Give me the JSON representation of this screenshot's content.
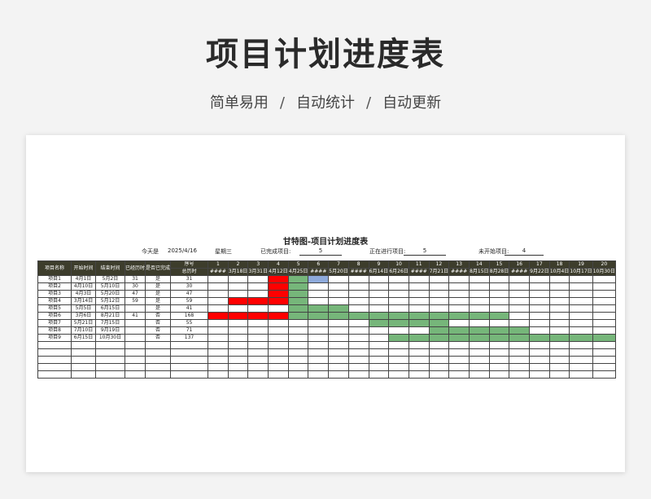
{
  "header": {
    "title": "项目计划进度表",
    "tagline": [
      "简单易用",
      "自动统计",
      "自动更新"
    ],
    "separator": "/"
  },
  "sheet": {
    "title": "甘特图-项目计划进度表",
    "today_label": "今天是",
    "today_date": "2025/4/16",
    "weekday": "星期三",
    "done_label": "已完成项目:",
    "done_value": "5",
    "inprogress_label": "正在进行项目:",
    "inprogress_value": "5",
    "notstarted_label": "未开始项目:",
    "notstarted_value": "4"
  },
  "table": {
    "columns": [
      "项目名称",
      "开始时间",
      "结束时间",
      "已经历时",
      "是否已完成",
      "序号"
    ],
    "total_label": "总历时",
    "day_numbers": [
      "1",
      "2",
      "3",
      "4",
      "5",
      "6",
      "7",
      "8",
      "9",
      "10",
      "11",
      "12",
      "13",
      "14",
      "15",
      "16",
      "17",
      "18",
      "19",
      "20"
    ],
    "day_dates": [
      "####",
      "3月18日",
      "3月31日",
      "4月12日",
      "4月25日",
      "####",
      "5月20日",
      "####",
      "6月14日",
      "6月26日",
      "####",
      "7月21日",
      "####",
      "8月15日",
      "8月28日",
      "####",
      "9月22日",
      "10月4日",
      "10月17日",
      "10月30日"
    ],
    "rows": [
      {
        "name": "项目1",
        "start": "4月1日",
        "end": "5月2日",
        "elapsed": "31",
        "done": "是",
        "total": "31"
      },
      {
        "name": "项目2",
        "start": "4月10日",
        "end": "5月10日",
        "elapsed": "30",
        "done": "是",
        "total": "30"
      },
      {
        "name": "项目3",
        "start": "4月3日",
        "end": "5月20日",
        "elapsed": "47",
        "done": "是",
        "total": "47"
      },
      {
        "name": "项目4",
        "start": "3月14日",
        "end": "5月12日",
        "elapsed": "59",
        "done": "是",
        "total": "59"
      },
      {
        "name": "项目5",
        "start": "5月5日",
        "end": "6月15日",
        "elapsed": "",
        "done": "是",
        "total": "41"
      },
      {
        "name": "项目6",
        "start": "3月6日",
        "end": "8月21日",
        "elapsed": "41",
        "done": "否",
        "total": "168"
      },
      {
        "name": "项目7",
        "start": "5月21日",
        "end": "7月15日",
        "elapsed": "",
        "done": "否",
        "total": "55"
      },
      {
        "name": "项目8",
        "start": "7月10日",
        "end": "9月19日",
        "elapsed": "",
        "done": "否",
        "total": "71"
      },
      {
        "name": "项目9",
        "start": "6月15日",
        "end": "10月30日",
        "elapsed": "",
        "done": "否",
        "total": "137"
      },
      {
        "name": "",
        "start": "",
        "end": "",
        "elapsed": "",
        "done": "",
        "total": ""
      },
      {
        "name": "",
        "start": "",
        "end": "",
        "elapsed": "",
        "done": "",
        "total": ""
      },
      {
        "name": "",
        "start": "",
        "end": "",
        "elapsed": "",
        "done": "",
        "total": ""
      },
      {
        "name": "",
        "start": "",
        "end": "",
        "elapsed": "",
        "done": "",
        "total": ""
      },
      {
        "name": "",
        "start": "",
        "end": "",
        "elapsed": "",
        "done": "",
        "total": ""
      }
    ],
    "gantt": [
      "...RG...............",
      "...RG...............",
      "...RG...............",
      ".RRRG...............",
      "....GGG.............",
      "RRRRGGGGGGGGGGG.....",
      "........GGGG........",
      "...........GGGGG....",
      ".........GGGGGGGGGGG"
    ],
    "gantt_blue_cells": [
      [
        0,
        5
      ]
    ],
    "colors": {
      "red": "#ff0000",
      "green": "#76b67a",
      "blue": "#8eaadb",
      "header": "#3d3d2c"
    }
  }
}
